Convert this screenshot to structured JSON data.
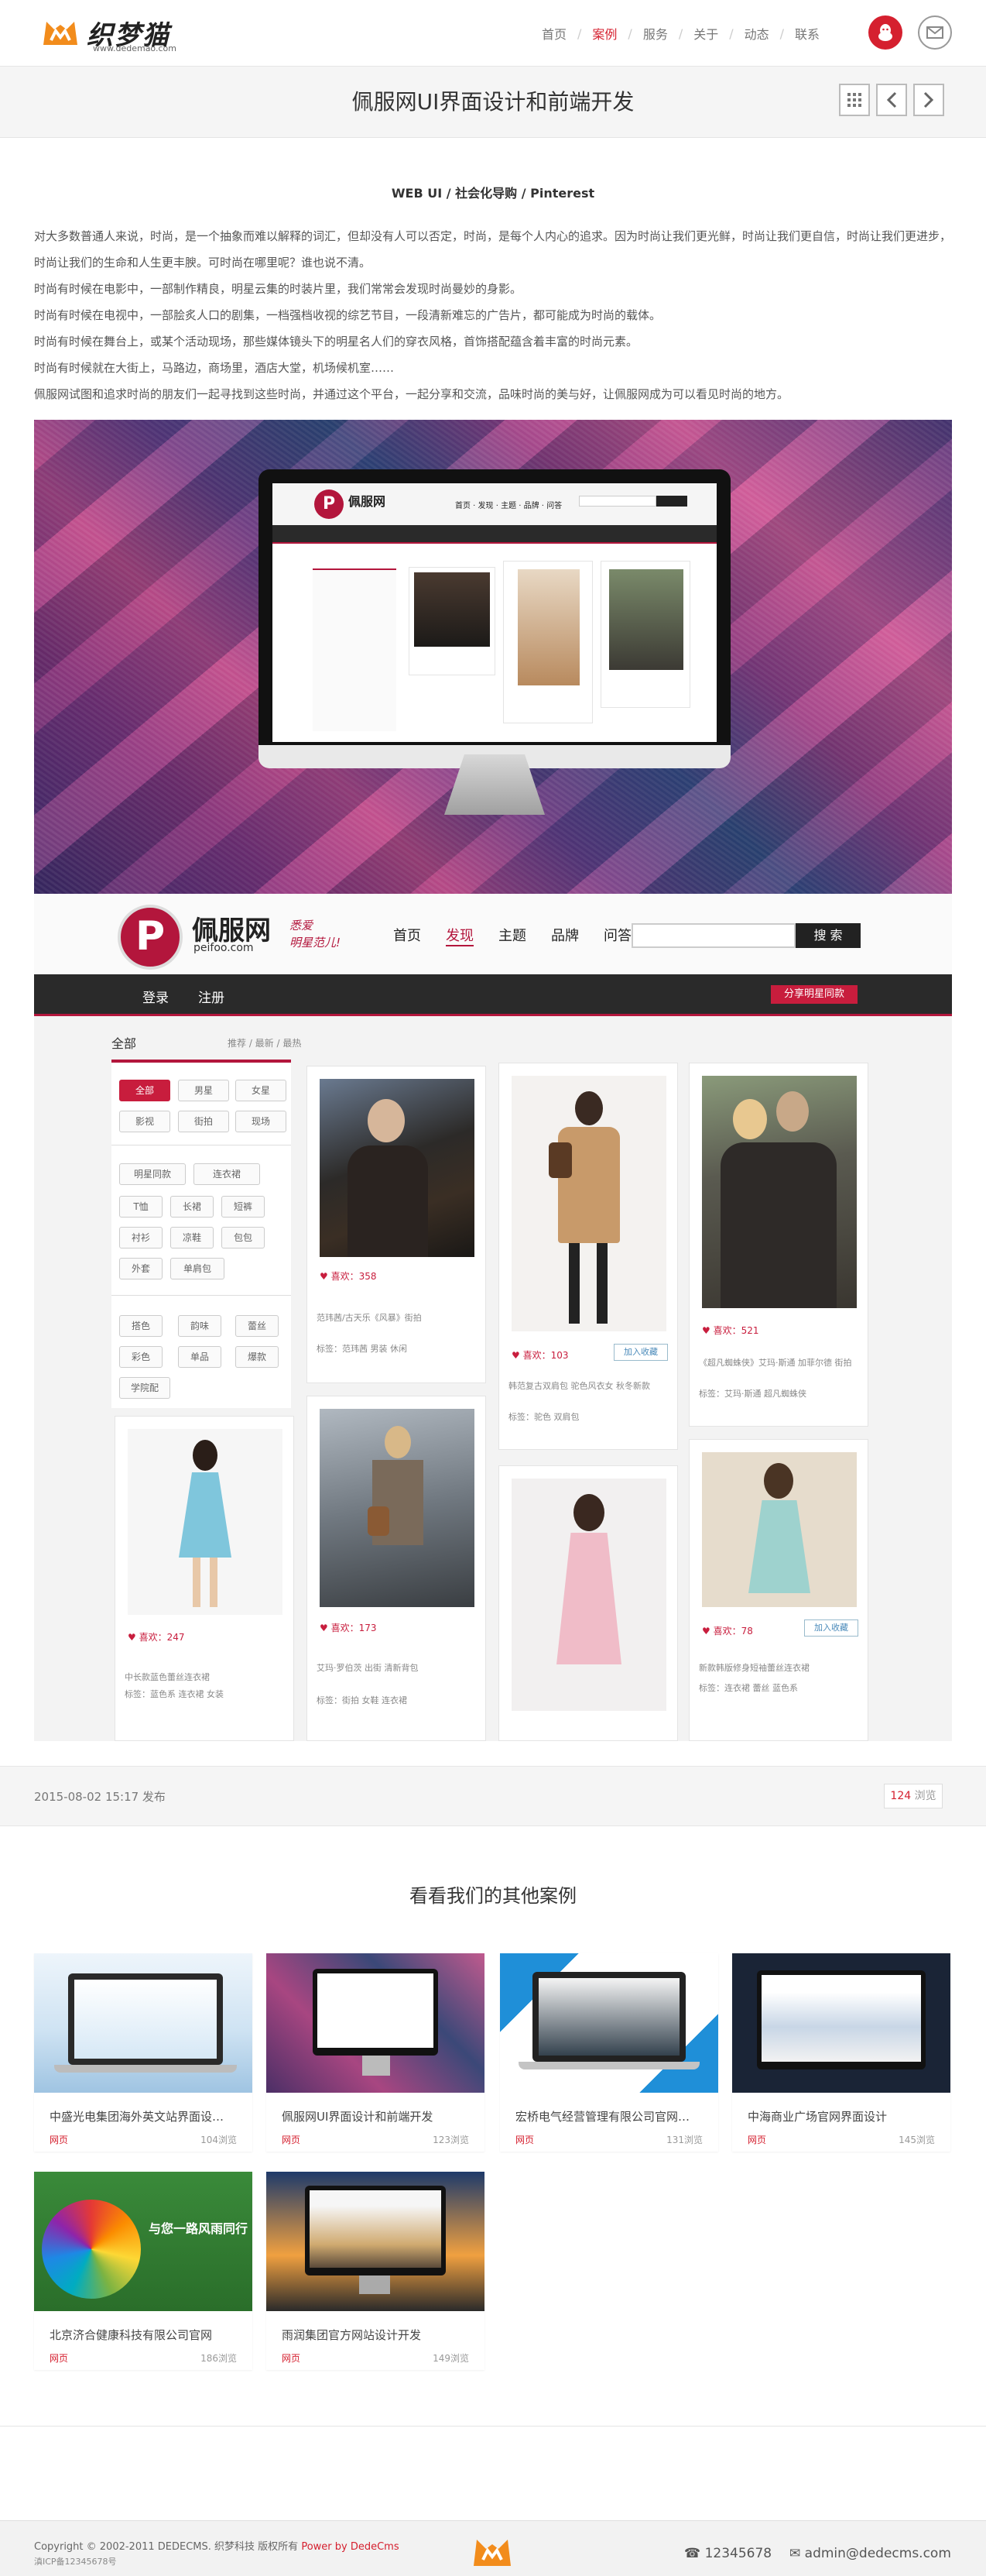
{
  "header": {
    "logo_text": "织梦猫",
    "logo_sub": "www.dedemao.com",
    "nav": [
      {
        "label": "首页"
      },
      {
        "label": "案例"
      },
      {
        "label": "服务"
      },
      {
        "label": "关于"
      },
      {
        "label": "动态"
      },
      {
        "label": "联系"
      }
    ],
    "active_nav": "案例"
  },
  "titlebar": {
    "title": "佩服网UI界面设计和前端开发"
  },
  "article": {
    "subtitle": "WEB UI / 社会化导购 / Pinterest",
    "paragraphs": [
      "对大多数普通人来说，时尚，是一个抽象而难以解释的词汇，但却没有人可以否定，时尚，是每个人内心的追求。因为时尚让我们更光鲜，时尚让我们更自信，时尚让我们更进步，时尚让我们的生命和人生更丰腴。可时尚在哪里呢？谁也说不清。",
      "时尚有时候在电影中，一部制作精良，明星云集的时装片里，我们常常会发现时尚曼妙的身影。",
      "时尚有时候在电视中，一部脍炙人口的剧集，一档强档收视的综艺节目，一段清新难忘的广告片，都可能成为时尚的载体。",
      "时尚有时候在舞台上，或某个活动现场，那些媒体镜头下的明星名人们的穿衣风格，首饰搭配蕴含着丰富的时尚元素。",
      "时尚有时候就在大街上，马路边，商场里，酒店大堂，机场候机室……",
      "佩服网试图和追求时尚的朋友们一起寻找到这些时尚，并通过这个平台，一起分享和交流，品味时尚的美与好，让佩服网成为可以看见时尚的地方。"
    ]
  },
  "mock": {
    "brand": "佩服网",
    "url": "peifoo.com",
    "slogan_1": "悉爱",
    "slogan_2": "明星范儿!",
    "nav": [
      "首页",
      "发现",
      "主题",
      "品牌",
      "问答"
    ],
    "search_btn": "搜 索",
    "login": "登录",
    "register": "注册",
    "share": "分享明星同款",
    "all": "全部",
    "crumb": "推荐 / 最新 / 最热",
    "tags": [
      "全部",
      "男星",
      "女星",
      "影视",
      "街拍",
      "现场",
      "明星同款",
      "连衣裙",
      "T恤",
      "长裙",
      "短裤",
      "衬衫",
      "凉鞋",
      "包包",
      "外套",
      "单肩包",
      "搭色",
      "韵味",
      "蕾丝",
      "彩色",
      "单品",
      "爆款",
      "学院配"
    ],
    "cards": [
      {
        "likes": "喜欢：358",
        "text": "范玮茜/古天乐《风暴》街拍",
        "meta": "标签：范玮茜 男装 休闲"
      },
      {
        "likes": "喜欢：103",
        "btn": "加入收藏",
        "text": "韩范复古双肩包 驼色风衣女 秋冬新款",
        "meta": "标签：驼色 双肩包"
      },
      {
        "likes": "喜欢：521",
        "text": "《超凡蜘蛛侠》艾玛·斯通 加菲尔德 街拍",
        "meta": "标签：艾玛·斯通 超凡蜘蛛侠 "
      },
      {
        "likes": "喜欢：247",
        "text": "中长款蓝色蕾丝连衣裙",
        "meta": "标签：蓝色系 连衣裙 女装"
      },
      {
        "likes": "喜欢：173",
        "text": "艾玛·罗伯茨 出街 清新背包",
        "meta": "标签：街拍 女鞋 连衣裙"
      },
      {
        "likes": "喜欢：78",
        "btn": "加入收藏",
        "text": "新款韩版修身短袖蕾丝连衣裙",
        "meta": "标签：连衣裙 蕾丝 蓝色系"
      }
    ]
  },
  "publish": {
    "date": "2015-08-02 15:17 发布",
    "views_num": "124",
    "views_unit": "浏览"
  },
  "others": {
    "title": "看看我们的其他案例",
    "cases": [
      {
        "name": "中盛光电集团海外英文站界面设…",
        "tag": "网页",
        "views": "104浏览"
      },
      {
        "name": "佩服网UI界面设计和前端开发",
        "tag": "网页",
        "views": "123浏览"
      },
      {
        "name": "宏桥电气经营管理有限公司官网…",
        "tag": "网页",
        "views": "131浏览"
      },
      {
        "name": "中海商业广场官网界面设计",
        "tag": "网页",
        "views": "145浏览"
      },
      {
        "name": "北京济合健康科技有限公司官网",
        "tag": "网页",
        "views": "186浏览"
      },
      {
        "name": "雨润集团官方网站设计开发",
        "tag": "网页",
        "views": "149浏览"
      }
    ],
    "case2_banner": "与您一路风雨同行"
  },
  "footer": {
    "copyright": "Copyright © 2002-2011 DEDECMS. 织梦科技 版权所有 ",
    "powered": "Power by DedeCms",
    "icp": "滇ICP备12345678号",
    "phone": "12345678",
    "email": "admin@dedecms.com"
  },
  "colors": {
    "accent": "#d5202f",
    "brand_mock": "#b3163c"
  }
}
